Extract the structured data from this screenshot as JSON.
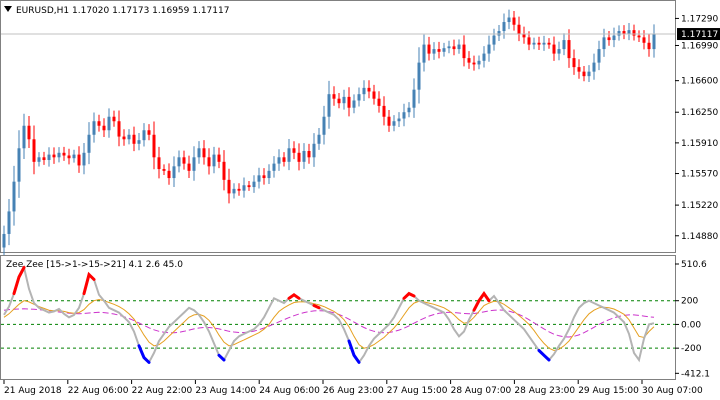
{
  "header": {
    "symbol_timeframe": "EURUSD,H1",
    "ohlc": "1.17020 1.17173 1.16959 1.17117"
  },
  "indicator": {
    "label": "Zee Zee [15->1->15->21] 4.1 2.6 45.0"
  },
  "colors": {
    "bull": "#4682b4",
    "bear": "#ff0000",
    "grid_level": "#008000",
    "magenta_line": "#cc33cc",
    "orange_line": "#e6a020",
    "gray_line": "#b4b4b4",
    "current_price_bg": "#000000",
    "border": "#808080"
  },
  "chart_data": [
    {
      "type": "candlestick",
      "name": "EURUSD,H1",
      "ylim": [
        1.147,
        1.1745
      ],
      "price_ticks": [
        "1.17290",
        "1.16990",
        "1.16600",
        "1.16250",
        "1.15910",
        "1.15570",
        "1.15220",
        "1.14880"
      ],
      "current_price": "1.17117",
      "x_tick_labels": [
        "21 Aug 2018",
        "22 Aug 06:00",
        "22 Aug 22:00",
        "23 Aug 14:00",
        "24 Aug 06:00",
        "26 Aug 23:00",
        "27 Aug 15:00",
        "28 Aug 07:00",
        "28 Aug 23:00",
        "29 Aug 15:00",
        "30 Aug 07:00"
      ],
      "close": [
        1.149,
        1.1515,
        1.1548,
        1.1585,
        1.161,
        1.1595,
        1.157,
        1.1575,
        1.1572,
        1.1578,
        1.1575,
        1.158,
        1.1577,
        1.1574,
        1.1578,
        1.1566,
        1.158,
        1.16,
        1.1615,
        1.161,
        1.1605,
        1.162,
        1.1615,
        1.1598,
        1.1595,
        1.16,
        1.159,
        1.1594,
        1.1605,
        1.16,
        1.1575,
        1.1562,
        1.156,
        1.1552,
        1.1565,
        1.1575,
        1.1568,
        1.156,
        1.1575,
        1.1585,
        1.1575,
        1.1565,
        1.1578,
        1.157,
        1.155,
        1.1535,
        1.154,
        1.1538,
        1.1544,
        1.1542,
        1.1548,
        1.1555,
        1.1552,
        1.156,
        1.1568,
        1.1575,
        1.157,
        1.1585,
        1.158,
        1.157,
        1.1582,
        1.1575,
        1.159,
        1.16,
        1.162,
        1.1645,
        1.164,
        1.1635,
        1.1642,
        1.163,
        1.1638,
        1.1645,
        1.1652,
        1.1648,
        1.164,
        1.1632,
        1.162,
        1.161,
        1.1615,
        1.1618,
        1.1625,
        1.163,
        1.165,
        1.168,
        1.17,
        1.169,
        1.1695,
        1.1692,
        1.1696,
        1.1698,
        1.1695,
        1.17,
        1.1685,
        1.168,
        1.1678,
        1.1682,
        1.169,
        1.17,
        1.171,
        1.1715,
        1.1725,
        1.173,
        1.1722,
        1.1712,
        1.1708,
        1.17,
        1.1702,
        1.17,
        1.1702,
        1.17,
        1.169,
        1.1695,
        1.1705,
        1.1685,
        1.1675,
        1.167,
        1.1665,
        1.167,
        1.168,
        1.1695,
        1.1708,
        1.1705,
        1.171,
        1.1715,
        1.1712,
        1.1716,
        1.171,
        1.1708,
        1.1702,
        1.1695,
        1.1712
      ],
      "current_index": 130
    },
    {
      "type": "line",
      "name": "Zee Zee [15->1->15->21] 4.1 2.6 45.0",
      "ylim": [
        -460,
        560
      ],
      "y_tick_labels": [
        "510.6",
        "200",
        "0.00",
        "-200",
        "-412.1"
      ],
      "levels": [
        200,
        0,
        -200
      ],
      "series": [
        {
          "role": "zee-main",
          "values": [
            80,
            150,
            260,
            400,
            480,
            300,
            180,
            140,
            120,
            100,
            110,
            130,
            90,
            60,
            80,
            140,
            260,
            420,
            380,
            250,
            200,
            140,
            120,
            100,
            60,
            20,
            -60,
            -180,
            -280,
            -320,
            -240,
            -140,
            -80,
            -20,
            20,
            60,
            100,
            140,
            120,
            80,
            20,
            -60,
            -160,
            -260,
            -300,
            -220,
            -140,
            -100,
            -80,
            -60,
            -40,
            0,
            60,
            140,
            220,
            200,
            180,
            220,
            250,
            220,
            200,
            180,
            160,
            140,
            120,
            100,
            80,
            40,
            -40,
            -140,
            -260,
            -320,
            -260,
            -180,
            -120,
            -80,
            -40,
            0,
            60,
            140,
            220,
            260,
            240,
            200,
            180,
            160,
            140,
            120,
            100,
            40,
            -40,
            -100,
            -60,
            40,
            120,
            200,
            260,
            200,
            240,
            180,
            120,
            80,
            40,
            0,
            -40,
            -100,
            -160,
            -220,
            -260,
            -300,
            -250,
            -180,
            -120,
            -40,
            60,
            140,
            180,
            200,
            180,
            160,
            140,
            120,
            100,
            60,
            20,
            -80,
            -240,
            -300,
            -120,
            0,
            10
          ]
        },
        {
          "role": "signal-orange",
          "values": [
            60,
            90,
            130,
            170,
            200,
            190,
            170,
            150,
            135,
            120,
            115,
            115,
            110,
            100,
            95,
            100,
            125,
            170,
            200,
            210,
            200,
            185,
            170,
            150,
            125,
            90,
            45,
            -20,
            -90,
            -150,
            -180,
            -170,
            -140,
            -100,
            -60,
            -20,
            20,
            60,
            80,
            85,
            70,
            35,
            -20,
            -90,
            -150,
            -180,
            -170,
            -150,
            -130,
            -110,
            -90,
            -70,
            -40,
            0,
            60,
            110,
            140,
            165,
            185,
            190,
            190,
            185,
            175,
            165,
            150,
            130,
            110,
            80,
            40,
            -20,
            -100,
            -170,
            -200,
            -190,
            -170,
            -140,
            -110,
            -70,
            -30,
            20,
            80,
            140,
            180,
            195,
            190,
            180,
            170,
            155,
            140,
            115,
            80,
            40,
            10,
            20,
            60,
            110,
            160,
            180,
            195,
            190,
            170,
            140,
            110,
            75,
            40,
            0,
            -50,
            -110,
            -160,
            -200,
            -220,
            -210,
            -180,
            -140,
            -80,
            -20,
            40,
            90,
            120,
            140,
            145,
            140,
            130,
            110,
            85,
            40,
            -30,
            -100,
            -110,
            -60,
            -20
          ]
        },
        {
          "role": "signal-magenta",
          "values": [
            120,
            125,
            128,
            130,
            132,
            130,
            128,
            124,
            120,
            115,
            110,
            105,
            100,
            95,
            92,
            90,
            92,
            96,
            100,
            102,
            100,
            95,
            88,
            78,
            65,
            50,
            32,
            12,
            -8,
            -28,
            -45,
            -58,
            -66,
            -70,
            -70,
            -66,
            -58,
            -48,
            -38,
            -30,
            -26,
            -26,
            -30,
            -38,
            -48,
            -58,
            -64,
            -68,
            -68,
            -64,
            -56,
            -44,
            -30,
            -14,
            4,
            22,
            40,
            58,
            74,
            88,
            100,
            108,
            114,
            116,
            114,
            108,
            98,
            84,
            66,
            44,
            20,
            -4,
            -26,
            -44,
            -58,
            -66,
            -70,
            -68,
            -60,
            -48,
            -32,
            -12,
            10,
            32,
            52,
            70,
            84,
            94,
            100,
            102,
            100,
            96,
            92,
            90,
            92,
            98,
            106,
            114,
            120,
            122,
            120,
            112,
            100,
            84,
            64,
            40,
            14,
            -12,
            -38,
            -62,
            -82,
            -96,
            -104,
            -106,
            -100,
            -88,
            -70,
            -48,
            -24,
            0,
            22,
            40,
            56,
            68,
            76,
            80,
            80,
            76,
            70,
            64,
            60
          ]
        }
      ],
      "highlight_segments": [
        {
          "color": "red",
          "start": 2,
          "end": 4
        },
        {
          "color": "red",
          "start": 16,
          "end": 18
        },
        {
          "color": "blue",
          "start": 27,
          "end": 29
        },
        {
          "color": "blue",
          "start": 43,
          "end": 44
        },
        {
          "color": "red",
          "start": 57,
          "end": 59
        },
        {
          "color": "red",
          "start": 62,
          "end": 63
        },
        {
          "color": "blue",
          "start": 69,
          "end": 71
        },
        {
          "color": "red",
          "start": 80,
          "end": 82
        },
        {
          "color": "red",
          "start": 94,
          "end": 97
        },
        {
          "color": "blue",
          "start": 107,
          "end": 109
        }
      ]
    }
  ]
}
